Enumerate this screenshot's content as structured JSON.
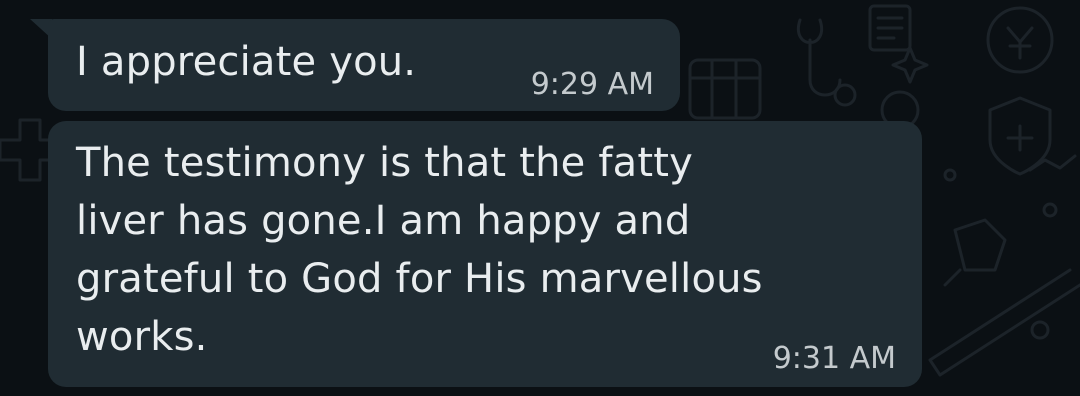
{
  "messages": [
    {
      "text": "I appreciate you.",
      "time": "9:29 AM"
    },
    {
      "text": "The testimony is that the fatty\nliver has gone.I am happy and\ngrateful to God for His marvellous\nworks.",
      "time": "9:31 AM"
    }
  ],
  "colors": {
    "background": "#0b1014",
    "bubble": "#202c33",
    "text": "#e9edef",
    "timestamp": "#c4cacd"
  }
}
